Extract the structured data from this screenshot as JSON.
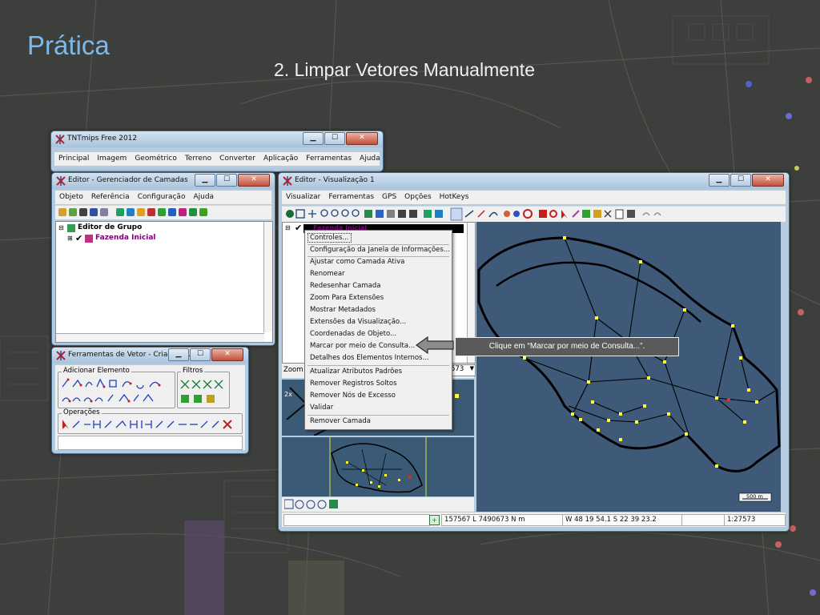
{
  "slide": {
    "title": "Prática",
    "subtitle": "2. Limpar Vetores Manualmente"
  },
  "main_window": {
    "title": "TNTmips Free 2012",
    "menu": [
      "Principal",
      "Imagem",
      "Geométrico",
      "Terreno",
      "Converter",
      "Aplicação",
      "Ferramentas",
      "Ajuda"
    ]
  },
  "layer_manager": {
    "title": "Editor - Gerenciador de Camadas",
    "menu": [
      "Objeto",
      "Referência",
      "Configuração",
      "Ajuda"
    ],
    "tree": {
      "group": "Editor de Grupo",
      "layer": "Fazenda Inicial"
    }
  },
  "vector_tools": {
    "title": "Ferramentas de Vetor - Criado p...",
    "group_add": "Adicionar Elemento",
    "group_filters": "Filtros",
    "group_ops": "Operações"
  },
  "view_window": {
    "title": "Editor - Visualização 1",
    "menu": [
      "Visualizar",
      "Ferramentas",
      "GPS",
      "Opções",
      "HotKeys"
    ],
    "layer_highlight": "Fazenda Inicial",
    "zoom_label": "Zoom",
    "zoom_value": "573",
    "side_label": "2x",
    "scale_bar": "500 m",
    "status": {
      "coords": "157567 L  7490673 N m",
      "latlon": "W 48 19 54.1  S 22 39 23.2",
      "scale": "1:27573"
    }
  },
  "context_menu": {
    "items": [
      "Controles...",
      "Configuração da Janela de Informações...",
      "Ajustar como Camada Ativa",
      "Renomear",
      "Redesenhar Camada",
      "Zoom Para Extensões",
      "Mostrar Metadados",
      "Extensões da Visualização...",
      "Coordenadas de Objeto...",
      "Marcar por meio de Consulta...",
      "Detalhes dos Elementos Internos...",
      "Atualizar Atributos Padrões",
      "Remover Registros Soltos",
      "Remover Nós de Excesso",
      "Validar",
      "Remover Camada"
    ]
  },
  "callout": {
    "text": "Clique em “Marcar por meio de Consulta...”."
  },
  "colors": {
    "title_blue": "#7fb8e8",
    "map_bg": "#3e5a78",
    "node_yellow": "#ffff3a",
    "layer_purple": "#800080"
  }
}
